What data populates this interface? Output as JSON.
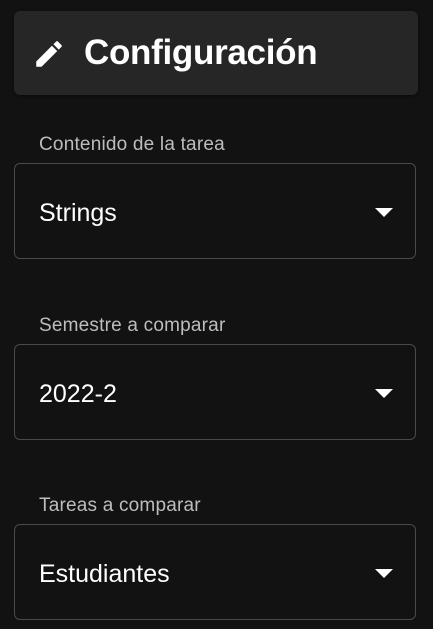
{
  "header": {
    "title": "Configuración",
    "icon": "pencil-icon"
  },
  "fields": [
    {
      "label": "Contenido de la tarea",
      "value": "Strings"
    },
    {
      "label": "Semestre a comparar",
      "value": "2022-2"
    },
    {
      "label": "Tareas a comparar",
      "value": "Estudiantes"
    }
  ],
  "colors": {
    "background": "#121212",
    "header_background": "#262626",
    "border": "#4a4a4a",
    "label": "#bdbdbd",
    "text": "#ffffff"
  }
}
